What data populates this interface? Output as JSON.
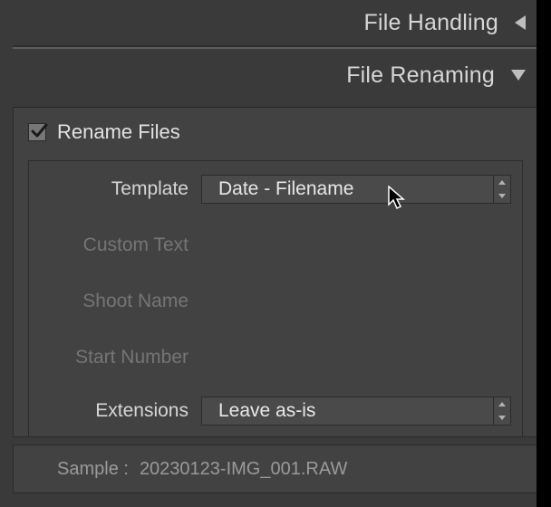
{
  "sections": {
    "file_handling": {
      "title": "File Handling",
      "expanded": false
    },
    "file_renaming": {
      "title": "File Renaming",
      "expanded": true
    }
  },
  "rename_checkbox": {
    "label": "Rename Files",
    "checked": true
  },
  "form": {
    "template": {
      "label": "Template",
      "value": "Date - Filename",
      "enabled": true
    },
    "custom_text": {
      "label": "Custom Text",
      "value": "",
      "enabled": false
    },
    "shoot_name": {
      "label": "Shoot Name",
      "value": "",
      "enabled": false
    },
    "start_number": {
      "label": "Start Number",
      "value": "",
      "enabled": false
    },
    "extensions": {
      "label": "Extensions",
      "value": "Leave as-is",
      "enabled": true
    }
  },
  "sample": {
    "label": "Sample :",
    "value": "20230123-IMG_001.RAW"
  },
  "colors": {
    "panel_bg": "#424242",
    "text": "#d6d6d6",
    "disabled_text": "#757575"
  }
}
